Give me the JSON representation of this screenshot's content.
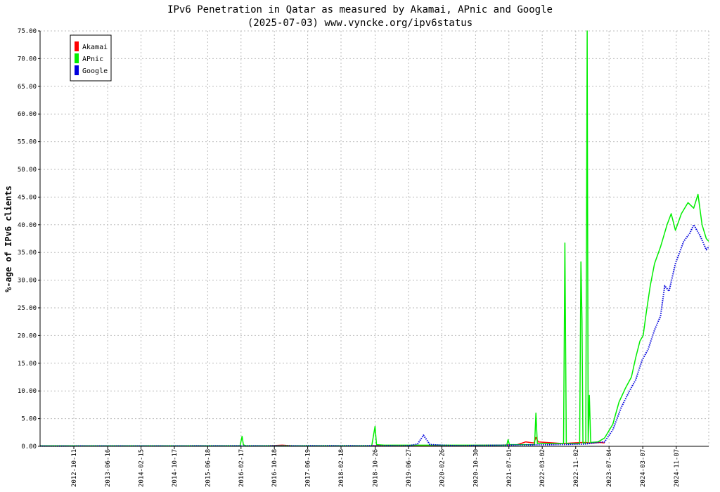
{
  "chart_data": {
    "type": "line",
    "title": "IPv6 Penetration in Qatar as measured by Akamai, APnic and Google",
    "subtitle": "(2025-07-03) www.vyncke.org/ipv6status",
    "xlabel": "",
    "ylabel": "%-age of IPv6 clients",
    "ylim": [
      0,
      75
    ],
    "yticks": [
      "0.00",
      "5.00",
      "10.00",
      "15.00",
      "20.00",
      "25.00",
      "30.00",
      "35.00",
      "40.00",
      "45.00",
      "50.00",
      "55.00",
      "60.00",
      "65.00",
      "70.00",
      "75.00"
    ],
    "xticks": [
      "2012-10-11",
      "2013-06-16",
      "2014-02-15",
      "2014-10-17",
      "2015-06-18",
      "2016-02-17",
      "2016-10-18",
      "2017-06-19",
      "2018-02-18",
      "2018-10-26",
      "2019-06-27",
      "2020-02-26",
      "2020-10-30",
      "2021-07-01",
      "2022-03-02",
      "2022-11-02",
      "2023-07-04",
      "2024-03-07",
      "2024-11-07"
    ],
    "x_range": [
      "2012-02-07",
      "2025-07-03"
    ],
    "grid": true,
    "legend_position": "top-left",
    "series": [
      {
        "name": "Akamai",
        "color": "#ff0000",
        "style": "line",
        "points": [
          [
            "2016-09-01",
            0.1
          ],
          [
            "2016-12-15",
            0.2
          ],
          [
            "2017-03-01",
            0.1
          ],
          [
            "2017-06-01",
            0.1
          ],
          [
            "2018-02-01",
            0.1
          ],
          [
            "2019-01-01",
            0.1
          ],
          [
            "2020-01-01",
            0.1
          ],
          [
            "2021-05-01",
            0.2
          ],
          [
            "2021-09-01",
            0.3
          ],
          [
            "2021-11-01",
            0.8
          ],
          [
            "2022-01-01",
            0.6
          ],
          [
            "2022-01-15",
            1.6
          ],
          [
            "2022-02-01",
            0.8
          ],
          [
            "2022-04-01",
            0.7
          ],
          [
            "2022-06-01",
            0.6
          ],
          [
            "2022-08-01",
            0.5
          ],
          [
            "2022-10-01",
            0.6
          ],
          [
            "2023-01-01",
            0.7
          ],
          [
            "2023-03-01",
            0.6
          ],
          [
            "2023-05-01",
            0.7
          ],
          [
            "2023-06-01",
            0.6
          ]
        ]
      },
      {
        "name": "APnic",
        "color": "#00ee00",
        "style": "line",
        "points": [
          [
            "2012-02-07",
            0.1
          ],
          [
            "2016-02-10",
            0.1
          ],
          [
            "2016-02-25",
            1.8
          ],
          [
            "2016-03-05",
            0.3
          ],
          [
            "2016-03-20",
            0.1
          ],
          [
            "2018-10-01",
            0.1
          ],
          [
            "2018-10-25",
            3.6
          ],
          [
            "2018-11-05",
            0.3
          ],
          [
            "2019-01-01",
            0.2
          ],
          [
            "2021-06-15",
            0.2
          ],
          [
            "2021-06-25",
            1.2
          ],
          [
            "2021-07-05",
            0.3
          ],
          [
            "2022-01-05",
            0.3
          ],
          [
            "2022-01-15",
            6.0
          ],
          [
            "2022-01-25",
            0.5
          ],
          [
            "2022-08-05",
            0.5
          ],
          [
            "2022-08-15",
            36.7
          ],
          [
            "2022-08-25",
            0.5
          ],
          [
            "2022-12-01",
            0.5
          ],
          [
            "2022-12-10",
            33.3
          ],
          [
            "2022-12-18",
            23.0
          ],
          [
            "2022-12-25",
            0.6
          ],
          [
            "2023-01-15",
            0.6
          ],
          [
            "2023-01-25",
            75.0
          ],
          [
            "2023-02-01",
            0.6
          ],
          [
            "2023-02-10",
            9.2
          ],
          [
            "2023-02-20",
            0.7
          ],
          [
            "2023-04-15",
            0.8
          ],
          [
            "2023-06-01",
            1.5
          ],
          [
            "2023-08-01",
            4.0
          ],
          [
            "2023-09-15",
            8.0
          ],
          [
            "2023-11-01",
            10.5
          ],
          [
            "2023-12-15",
            12.5
          ],
          [
            "2024-01-15",
            16.0
          ],
          [
            "2024-02-15",
            19.0
          ],
          [
            "2024-03-10",
            20.0
          ],
          [
            "2024-04-01",
            24.0
          ],
          [
            "2024-05-01",
            29.0
          ],
          [
            "2024-06-01",
            33.0
          ],
          [
            "2024-07-15",
            36.0
          ],
          [
            "2024-09-01",
            40.0
          ],
          [
            "2024-10-01",
            42.0
          ],
          [
            "2024-11-01",
            39.0
          ],
          [
            "2024-12-15",
            42.0
          ],
          [
            "2025-02-01",
            44.0
          ],
          [
            "2025-03-15",
            43.0
          ],
          [
            "2025-04-15",
            45.5
          ],
          [
            "2025-05-15",
            40.0
          ],
          [
            "2025-06-15",
            37.5
          ],
          [
            "2025-07-03",
            37.0
          ]
        ]
      },
      {
        "name": "Google",
        "color": "#0000dd",
        "style": "dotted",
        "points": [
          [
            "2012-02-07",
            0.05
          ],
          [
            "2019-07-01",
            0.1
          ],
          [
            "2019-09-01",
            0.4
          ],
          [
            "2019-10-15",
            2.0
          ],
          [
            "2019-12-01",
            0.3
          ],
          [
            "2020-06-01",
            0.1
          ],
          [
            "2022-06-01",
            0.3
          ],
          [
            "2023-01-01",
            0.4
          ],
          [
            "2023-06-01",
            0.8
          ],
          [
            "2023-08-01",
            3.0
          ],
          [
            "2023-10-01",
            7.0
          ],
          [
            "2023-12-01",
            10.0
          ],
          [
            "2024-01-15",
            12.0
          ],
          [
            "2024-03-01",
            15.5
          ],
          [
            "2024-04-15",
            17.5
          ],
          [
            "2024-06-01",
            21.0
          ],
          [
            "2024-07-15",
            23.5
          ],
          [
            "2024-08-15",
            29.0
          ],
          [
            "2024-09-15",
            28.0
          ],
          [
            "2024-11-01",
            33.0
          ],
          [
            "2025-01-01",
            37.0
          ],
          [
            "2025-02-15",
            38.5
          ],
          [
            "2025-03-15",
            40.0
          ],
          [
            "2025-05-01",
            38.0
          ],
          [
            "2025-06-15",
            35.5
          ],
          [
            "2025-07-03",
            36.0
          ]
        ]
      }
    ]
  }
}
